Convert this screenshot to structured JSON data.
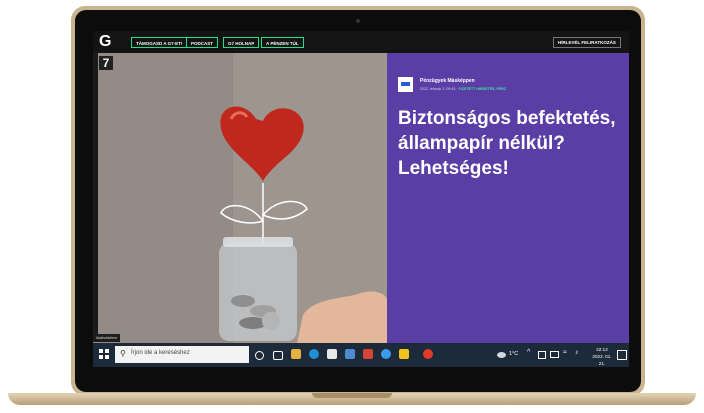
{
  "header": {
    "logo": "G",
    "nav": [
      "TÁMOGASD A G7-ET!",
      "PODCAST",
      "G7 HOLNAP",
      "A PÉNZEN TÚL"
    ],
    "newsletter": "HÍRLEVÉL FELIRATKOZÁS"
  },
  "sidebar": {
    "badge": "7"
  },
  "article": {
    "source": "Pénzügyek Másképpen",
    "date": "2022. február 2. 09:43",
    "tag": "FIZETETT HIRDETÉS, PÉNZ",
    "headline": "Biztonságos befektetés, állampapír nélkül? Lehetséges!"
  },
  "image": {
    "credit": "Adatvédelem"
  },
  "taskbar": {
    "search_placeholder": "Írjon ide a kereséshez",
    "weather": "1°C",
    "time": "22:12",
    "date": "2022. 01. 21."
  },
  "colors": {
    "accent": "#25e08a",
    "panel": "#5a3ea6",
    "taskbar": "#1c2a3a"
  }
}
